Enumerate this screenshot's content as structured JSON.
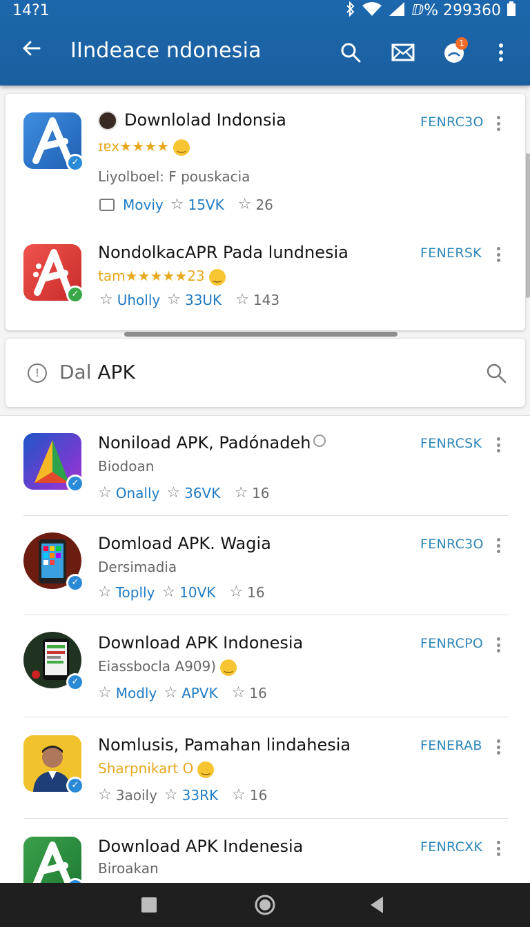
{
  "status_bar": {
    "time": "14?1",
    "right_text": "ⅅ% 299360",
    "icons": [
      "bluetooth-icon",
      "wifi-icon",
      "signal-icon",
      "battery-icon"
    ]
  },
  "app_bar": {
    "title": "IIndeace ndonesia",
    "notification_count": "1",
    "icons": [
      "back-arrow-icon",
      "search-icon",
      "mail-icon",
      "notification-icon",
      "more-vert-icon"
    ]
  },
  "featured": [
    {
      "name": "Downlolad Indonsia",
      "rating_text": "ɪɐx★★★★",
      "subtitle": "Liyolboel: F pouskacia",
      "meta_label": "Moviy",
      "meta_count": "15VK",
      "meta_num": "26",
      "tag": "FENRC3O",
      "icon_color": "#2a74c9",
      "verified_color": "#2a8ad6"
    },
    {
      "name": "NondolkacAPR Pada lundnesia",
      "rating_text": "tam★★★★★23",
      "meta_label": "Uholly",
      "meta_count": "33UK",
      "meta_num": "143",
      "tag": "FENERSK",
      "icon_color": "#e03a35",
      "verified_color": "#38a848"
    }
  ],
  "search": {
    "prefix": "Dal",
    "text": "APK"
  },
  "list": [
    {
      "name": "Noniload APK, Padónadeh",
      "subtitle": "Biodoan",
      "meta_label": "Onally",
      "meta_count": "36VK",
      "meta_num": "16",
      "tag": "FENRCSK"
    },
    {
      "name": "Domload APK. Wagia",
      "subtitle": "Dersimadia",
      "meta_label": "Toplly",
      "meta_count": "10VK",
      "meta_num": "16",
      "tag": "FENRC3O"
    },
    {
      "name": "Download APK Indonesia",
      "subtitle": "Eiassbocla A909)",
      "meta_label": "Modly",
      "meta_count": "APVK",
      "meta_num": "16",
      "tag": "FENRCPO"
    },
    {
      "name": "Nomlusis, Pamahan lindahesia",
      "subtitle": "Sharpnikart O",
      "meta_label": "3aoily",
      "meta_count": "33RK",
      "meta_num": "16",
      "tag": "FENERAB"
    },
    {
      "name": "Download APK Indenesia",
      "subtitle": "Biroakan",
      "tag": "FENRCXK"
    }
  ],
  "colors": {
    "appbar": "#1c67ad",
    "accent_blue": "#1e7bc4",
    "tag_blue": "#2c86b8",
    "gold": "#e6a81f"
  }
}
